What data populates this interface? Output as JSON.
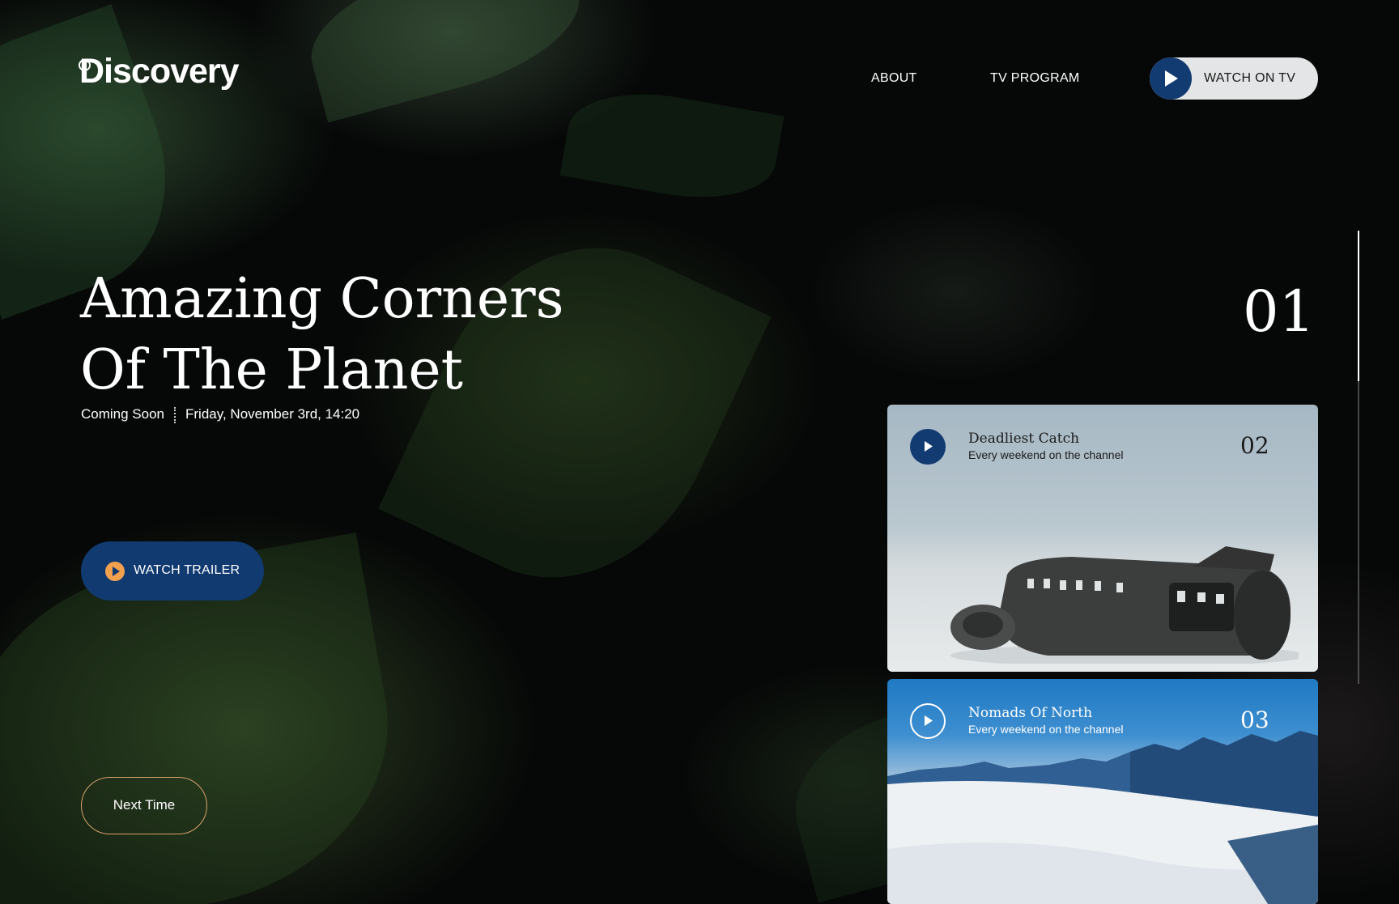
{
  "brand": {
    "name": "Discovery"
  },
  "nav": {
    "about": "ABOUT",
    "tv_program": "TV PROGRAM",
    "watch_on_tv": "WATCH ON TV"
  },
  "hero": {
    "title_line1": "Amazing Corners",
    "title_line2": "Of The Planet",
    "status": "Coming Soon",
    "datetime": "Friday, November 3rd, 14:20",
    "trailer_label": "WATCH TRAILER",
    "next_label": "Next Time",
    "index": "01"
  },
  "cards": [
    {
      "title": "Deadliest Catch",
      "subtitle": "Every weekend on the channel",
      "index": "02"
    },
    {
      "title": "Nomads Of North",
      "subtitle": "Every weekend on the channel",
      "index": "03"
    }
  ],
  "colors": {
    "accent": "#123b72",
    "trailer_icon": "#f4a14f",
    "next_border": "#d9a26a",
    "background": "#060807"
  },
  "icons": [
    "play-icon",
    "globe-icon"
  ]
}
